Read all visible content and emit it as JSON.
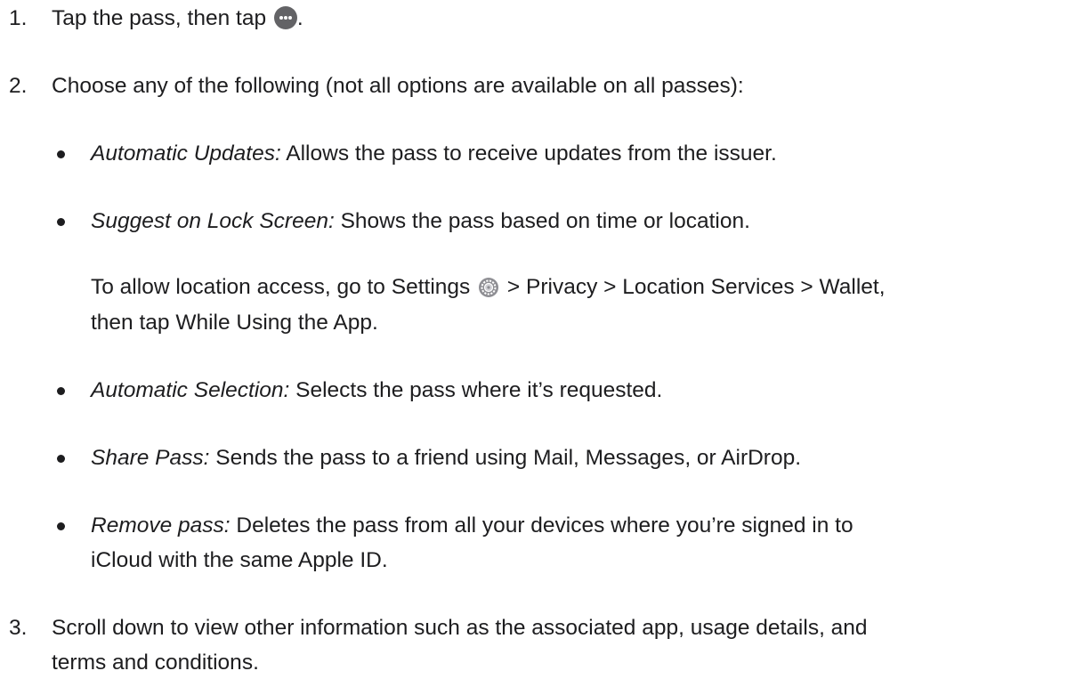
{
  "steps": [
    {
      "number": "1.",
      "text_before": "Tap the pass, then tap",
      "text_after": ".",
      "icon": "more-icon"
    },
    {
      "number": "2.",
      "text": "Choose any of the following (not all options are available on all passes):"
    },
    {
      "number": "3.",
      "lines": [
        "Scroll down to view other information such as the associated app, usage details, and",
        "terms and conditions."
      ]
    }
  ],
  "options": [
    {
      "term": "Automatic Updates:",
      "desc": " Allows the pass to receive updates from the issuer."
    },
    {
      "term": "Suggest on Lock Screen:",
      "desc": " Shows the pass based on time or location."
    },
    {
      "term": "Automatic Selection:",
      "desc": " Selects the pass where it’s requested."
    },
    {
      "term": "Share Pass:",
      "desc": " Sends the pass to a friend using Mail, Messages, or AirDrop."
    },
    {
      "term": "Remove pass:",
      "desc": " Deletes the pass from all your devices where you’re signed in to",
      "desc_line2": "iCloud with the same Apple ID."
    }
  ],
  "location_note": {
    "before": "To allow location access, go to Settings",
    "after": " > Privacy > Location Services > Wallet,",
    "line2": "then tap While Using the App.",
    "icon": "settings-icon"
  },
  "colors": {
    "text": "#1d1d1f",
    "icon_gray": "#636366"
  }
}
